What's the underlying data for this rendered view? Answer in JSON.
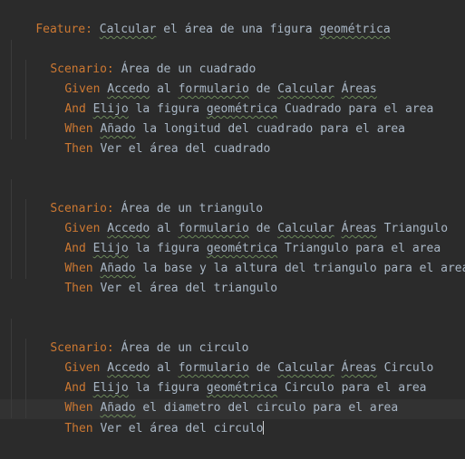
{
  "editor": {
    "feature": {
      "keyword": "Feature:",
      "words": [
        "Calcular",
        "el",
        "área",
        "de",
        "una",
        "figura",
        "geométrica"
      ]
    },
    "scenarios": [
      {
        "keyword": "Scenario:",
        "title": "Área de un cuadrado",
        "steps": [
          {
            "keyword": "Given",
            "text_parts": [
              "Accedo",
              " al ",
              "formulario",
              " de ",
              "Calcular",
              " ",
              "Áreas",
              ""
            ]
          },
          {
            "keyword": "And",
            "text_parts": [
              "Elijo",
              " la figura ",
              "geométrica",
              " Cuadrado para el area"
            ]
          },
          {
            "keyword": "When",
            "text_parts": [
              "Añado",
              " la longitud del cuadrado para el area"
            ]
          },
          {
            "keyword": "Then",
            "text_parts": [
              "Ver el área del cuadrado"
            ]
          }
        ]
      },
      {
        "keyword": "Scenario:",
        "title": "Área de un triangulo",
        "steps": [
          {
            "keyword": "Given",
            "text_parts": [
              "Accedo",
              " al ",
              "formulario",
              " de ",
              "Calcular",
              " ",
              "Áreas",
              " Triangulo"
            ]
          },
          {
            "keyword": "And",
            "text_parts": [
              "Elijo",
              " la figura ",
              "geométrica",
              " Triangulo para el area"
            ]
          },
          {
            "keyword": "When",
            "text_parts": [
              "Añado",
              " la base y la altura del triangulo para el area"
            ]
          },
          {
            "keyword": "Then",
            "text_parts": [
              "Ver el área del triangulo"
            ]
          }
        ]
      },
      {
        "keyword": "Scenario:",
        "title": "Área de un circulo",
        "steps": [
          {
            "keyword": "Given",
            "text_parts": [
              "Accedo",
              " al ",
              "formulario",
              " de ",
              "Calcular",
              " ",
              "Áreas",
              " Circulo"
            ]
          },
          {
            "keyword": "And",
            "text_parts": [
              "Elijo",
              " la figura ",
              "geométrica",
              " Circulo para el area"
            ]
          },
          {
            "keyword": "When",
            "text_parts": [
              "Añado",
              " el diametro del circulo para el area"
            ]
          },
          {
            "keyword": "Then",
            "text_parts": [
              "Ver el área del circulo"
            ]
          }
        ]
      }
    ]
  },
  "colors": {
    "background": "#2b2b2b",
    "keyword": "#cc7832",
    "text": "#a9b7c6",
    "spellcheck_underline": "#6a8759"
  }
}
